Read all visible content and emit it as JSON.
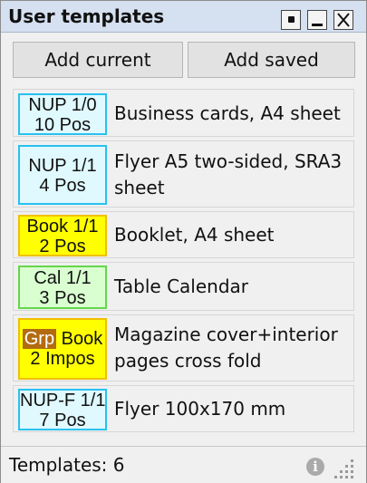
{
  "window": {
    "title": "User templates"
  },
  "toolbar": {
    "add_current_label": "Add current",
    "add_saved_label": "Add saved"
  },
  "templates": [
    {
      "badge_line1": "NUP 1/0",
      "badge_line2": "10 Pos",
      "badge_type": "nup",
      "description": "Business cards, A4 sheet"
    },
    {
      "badge_line1": "NUP 1/1",
      "badge_line2": "4 Pos",
      "badge_type": "nup",
      "description": "Flyer A5 two-sided, SRA3 sheet"
    },
    {
      "badge_line1": "Book 1/1",
      "badge_line2": "2 Pos",
      "badge_type": "book",
      "description": "Booklet, A4 sheet"
    },
    {
      "badge_line1": "Cal 1/1",
      "badge_line2": "3 Pos",
      "badge_type": "cal",
      "description": "Table Calendar"
    },
    {
      "badge_grp": "Grp",
      "badge_line1": "Book",
      "badge_line2": "2 Impos",
      "badge_type": "book",
      "description": "Magazine cover+interior pages cross fold"
    },
    {
      "badge_line1": "NUP-F 1/1",
      "badge_line2": "7 Pos",
      "badge_type": "nup",
      "description": "Flyer 100x170 mm"
    }
  ],
  "status": {
    "text": "Templates: 6"
  },
  "icons": {
    "pin": "pin-icon",
    "minimize": "minimize-icon",
    "close": "close-icon",
    "info": "info-icon",
    "resize_grip": "resize-grip-icon"
  },
  "colors": {
    "nup_fill": "#dff9ff",
    "nup_border": "#29c1f0",
    "book_fill": "#ffff00",
    "cal_fill": "#d9ffd0",
    "grp_fill": "#b36b10"
  }
}
